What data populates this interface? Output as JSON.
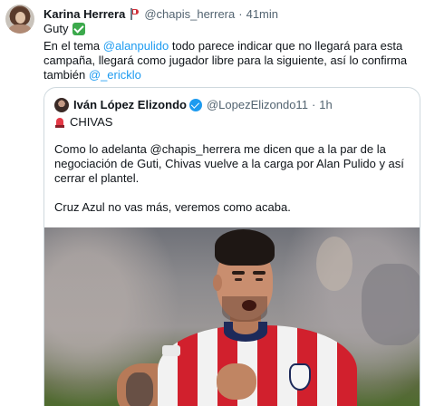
{
  "tweet": {
    "author_name": "Karina Herrera",
    "author_handle": "@chapis_herrera",
    "separator": "·",
    "time": "41min",
    "line1_text": "Guty",
    "body": {
      "part1": "En el tema ",
      "mention1": "@alanpulido",
      "part2": " todo parece indicar que no llegará para esta campaña, llegará como jugador libre para la siguiente, así lo confirma también ",
      "mention2": "@_ericklo"
    },
    "icons": {
      "flag": "flag-icon",
      "check": "check-mark-button-emoji"
    }
  },
  "quoted_tweet": {
    "author_name": "Iván López Elizondo",
    "author_handle": "@LopezElizondo11",
    "separator": "·",
    "time": "1h",
    "siren_line": "CHIVAS",
    "paragraph1": "Como lo adelanta @chapis_herrera me dicen que a la par de la negociación de Guti, Chivas vuelve a la carga por Alan Pulido y así cerrar el plantel.",
    "paragraph2": "Cruz Azul no vas más, veremos como acaba.",
    "icons": {
      "verified": "verified-badge-icon",
      "siren": "siren-emoji"
    },
    "colors": {
      "verified": "#1d9bf0",
      "shirt_red": "#d1202d"
    }
  },
  "colors": {
    "link": "#1d9bf0",
    "secondary_text": "#536471",
    "border": "#cfd9de"
  }
}
